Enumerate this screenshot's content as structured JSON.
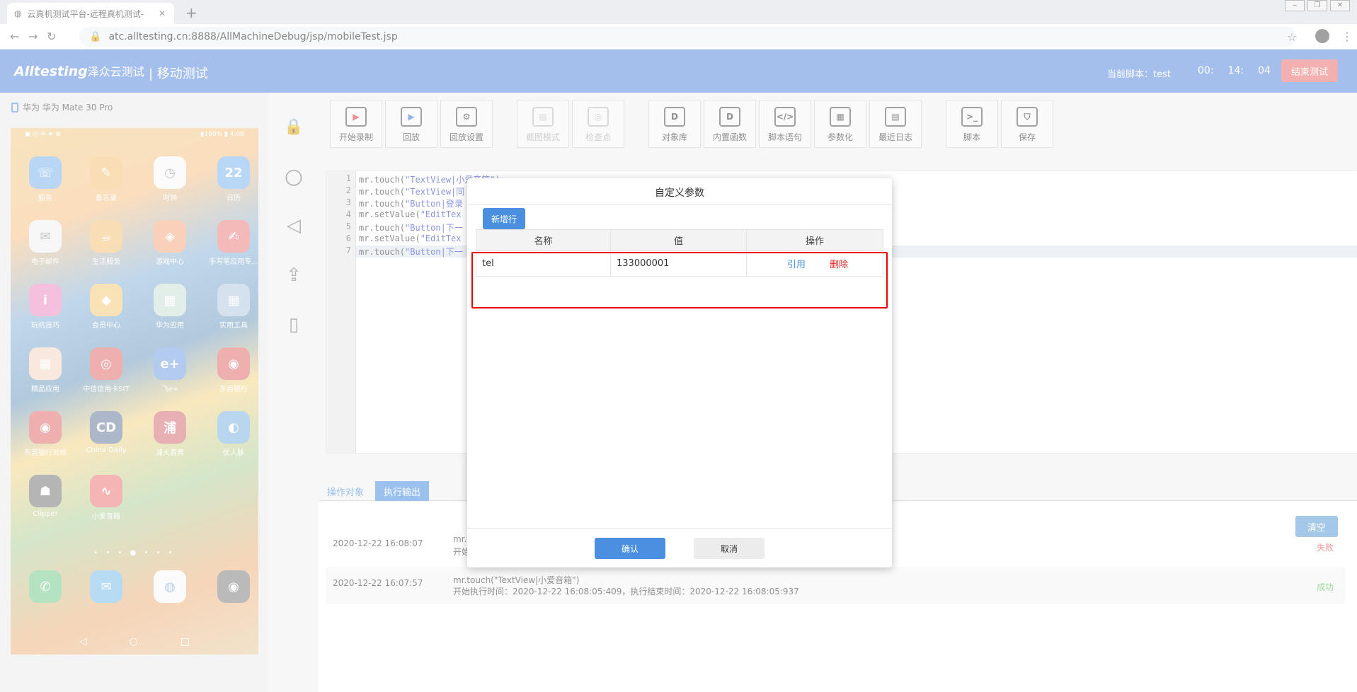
{
  "browser": {
    "tab_title": "云真机测试平台-远程真机测试-",
    "url": "atc.alltesting.cn:8888/AllMachineDebug/jsp/mobileTest.jsp"
  },
  "header": {
    "logo": "Alltesting",
    "logo_cn": "泽众云测试",
    "module": "| 移动测试",
    "current_script": "当前脚本：test",
    "timer": {
      "h": "00:",
      "m": "14:",
      "s": "04"
    },
    "end_button": "结束测试"
  },
  "device": {
    "name": "华为 华为 Mate 30 Pro",
    "status_left": "▣ ◎ ✉ ★ ⊕",
    "status_right": "▮100% ▮ 4:08",
    "apps": [
      {
        "label": "服务",
        "icon": "☏",
        "color": "#3c8de0"
      },
      {
        "label": "备忘录",
        "icon": "✎",
        "color": "#f0a030"
      },
      {
        "label": "时钟",
        "icon": "◷",
        "color": "#f5f5f5"
      },
      {
        "label": "日历",
        "icon": "22",
        "color": "#3a8fe8"
      },
      {
        "label": "电子邮件",
        "icon": "✉",
        "color": "#e8e8e8"
      },
      {
        "label": "生活服务",
        "icon": "☕",
        "color": "#f0a030"
      },
      {
        "label": "游戏中心",
        "icon": "◈",
        "color": "#f08040"
      },
      {
        "label": "手写笔应用专...",
        "icon": "✍",
        "color": "#e04040"
      },
      {
        "label": "玩机技巧",
        "icon": "i",
        "color": "#e050a0"
      },
      {
        "label": "会员中心",
        "icon": "◆",
        "color": "#f0b030"
      },
      {
        "label": "华为应用",
        "icon": "▦",
        "color": "#b0d0c0"
      },
      {
        "label": "实用工具",
        "icon": "▦",
        "color": "#8ab0d0"
      },
      {
        "label": "精品应用",
        "icon": "▦",
        "color": "#f0c0a0"
      },
      {
        "label": "中信信用卡SIT",
        "icon": "◎",
        "color": "#d02020"
      },
      {
        "label": "飞e+",
        "icon": "e+",
        "color": "#2a6fd0"
      },
      {
        "label": "东莞银行",
        "icon": "◉",
        "color": "#d02020"
      },
      {
        "label": "东莞银行对修",
        "icon": "◉",
        "color": "#d02020"
      },
      {
        "label": "China Daily",
        "icon": "CD",
        "color": "#1a3a6a"
      },
      {
        "label": "浦大喜奔",
        "icon": "浦",
        "color": "#c02030"
      },
      {
        "label": "优人脉",
        "icon": "◐",
        "color": "#3a90d0"
      },
      {
        "label": "Clipper",
        "icon": "☗",
        "color": "#303030"
      },
      {
        "label": "小爱音箱",
        "icon": "∿",
        "color": "#e03030"
      }
    ],
    "dots": "• • • ● • • •",
    "dock": [
      {
        "icon": "✆",
        "color": "#30b050"
      },
      {
        "icon": "✉",
        "color": "#3a9ae0"
      },
      {
        "icon": "◍",
        "color": "#f5f5f5"
      },
      {
        "icon": "◉",
        "color": "#404040"
      }
    ],
    "nav": {
      "back": "◁",
      "home": "○",
      "recent": "□"
    }
  },
  "sidebar": {
    "lock": "🔒",
    "home": "○",
    "back": "◁",
    "upload": "⇪",
    "rotate": "▯"
  },
  "toolbar": [
    {
      "label": "开始录制",
      "icon": "▶",
      "disabled": false
    },
    {
      "label": "回放",
      "icon": "▶",
      "disabled": false
    },
    {
      "label": "回放设置",
      "icon": "⚙",
      "disabled": false
    },
    {
      "label": "截图模式",
      "icon": "▨",
      "disabled": true
    },
    {
      "label": "检查点",
      "icon": "◎",
      "disabled": true
    },
    {
      "label": "对象库",
      "icon": "D",
      "disabled": false
    },
    {
      "label": "内置函数",
      "icon": "D",
      "disabled": false
    },
    {
      "label": "脚本语句",
      "icon": "</>",
      "disabled": false
    },
    {
      "label": "参数化",
      "icon": "▦",
      "disabled": false
    },
    {
      "label": "最近日志",
      "icon": "▤",
      "disabled": false
    },
    {
      "label": "脚本",
      "icon": ">_",
      "disabled": false
    },
    {
      "label": "保存",
      "icon": "⛉",
      "disabled": false
    }
  ],
  "code": [
    {
      "n": "1",
      "pre": "mr.touch(",
      "str": "\"TextView|小爱音箱\")"
    },
    {
      "n": "2",
      "pre": "mr.touch(",
      "str": "\"TextView|同"
    },
    {
      "n": "3",
      "pre": "mr.touch(",
      "str": "\"Button|登录"
    },
    {
      "n": "4",
      "pre": "mr.setValue(",
      "str": "\"EditTex"
    },
    {
      "n": "5",
      "pre": "mr.touch(",
      "str": "\"Button|下一"
    },
    {
      "n": "6",
      "pre": "mr.setValue(",
      "str": "\"EditTex"
    },
    {
      "n": "7",
      "pre": "mr.touch(",
      "str": "\"Button|下一"
    }
  ],
  "bottom_tabs": {
    "objects": "操作对象",
    "output": "执行输出"
  },
  "output": {
    "clear": "清空",
    "rows": [
      {
        "date": "2020-12-22 16:08:07",
        "line1": "mr.to",
        "line2": "开始执",
        "status": "失败",
        "status_color": "#e04040"
      },
      {
        "date": "2020-12-22 16:07:57",
        "line1": "mr.touch(\"TextView|小爱音箱\")",
        "line2": "开始执行时间：2020-12-22 16:08:05:409，执行结束时间：2020-12-22 16:08:05:937",
        "status": "成功",
        "status_color": "#40c040"
      }
    ]
  },
  "modal": {
    "title": "自定义参数",
    "add_row": "新增行",
    "columns": [
      "名称",
      "值",
      "操作"
    ],
    "rows": [
      {
        "name": "tel",
        "value": "133000001",
        "ref": "引用",
        "del": "删除"
      }
    ],
    "ok": "确认",
    "cancel": "取消"
  },
  "colors": {
    "header": "#5b8bdf",
    "primary": "#4a8fe0",
    "danger": "#e04040"
  }
}
